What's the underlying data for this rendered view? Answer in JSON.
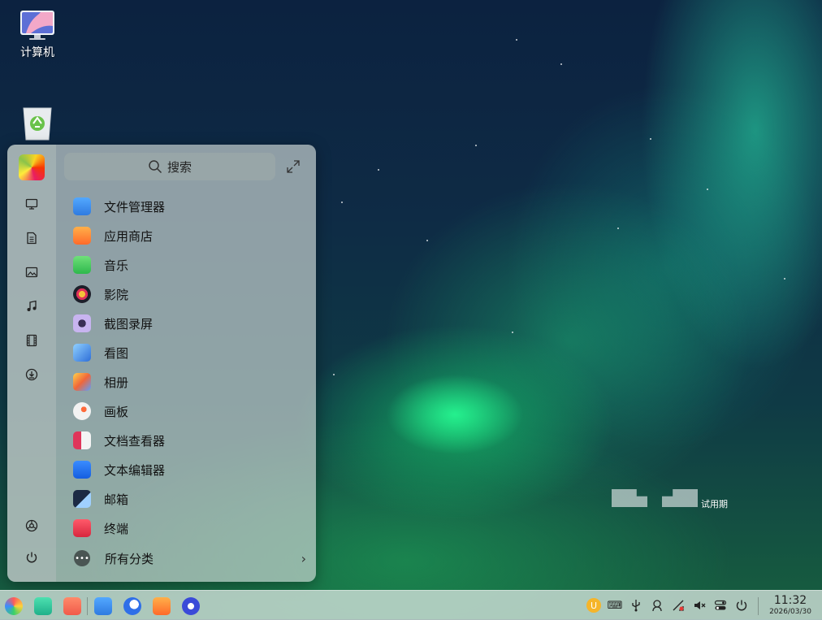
{
  "desktop": {
    "computer_label": "计算机",
    "trash_label": ""
  },
  "launcher": {
    "search_placeholder": "搜索",
    "apps": [
      {
        "label": "文件管理器",
        "icon": "file-manager-icon",
        "color": "#2f8cf0"
      },
      {
        "label": "应用商店",
        "icon": "app-store-icon",
        "color": "#ff7a2a"
      },
      {
        "label": "音乐",
        "icon": "music-icon",
        "color": "#3cc65a"
      },
      {
        "label": "影院",
        "icon": "movie-icon",
        "color": "#222222"
      },
      {
        "label": "截图录屏",
        "icon": "screenshot-icon",
        "color": "#9c7ad8"
      },
      {
        "label": "看图",
        "icon": "image-viewer-icon",
        "color": "#3a7fd8"
      },
      {
        "label": "相册",
        "icon": "album-icon",
        "color": "#f08a3a"
      },
      {
        "label": "画板",
        "icon": "draw-icon",
        "color": "#e9e9e9"
      },
      {
        "label": "文档查看器",
        "icon": "document-viewer-icon",
        "color": "#e0355a"
      },
      {
        "label": "文本编辑器",
        "icon": "text-editor-icon",
        "color": "#1a6ff0"
      },
      {
        "label": "邮箱",
        "icon": "mail-icon",
        "color": "#1c2a44"
      },
      {
        "label": "终端",
        "icon": "terminal-icon",
        "color": "#e0304a"
      }
    ],
    "all_categories_label": "所有分类"
  },
  "watermark": {
    "trial_text": "试用期"
  },
  "taskbar": {
    "time": "11:32",
    "date": "2026/03/30"
  }
}
